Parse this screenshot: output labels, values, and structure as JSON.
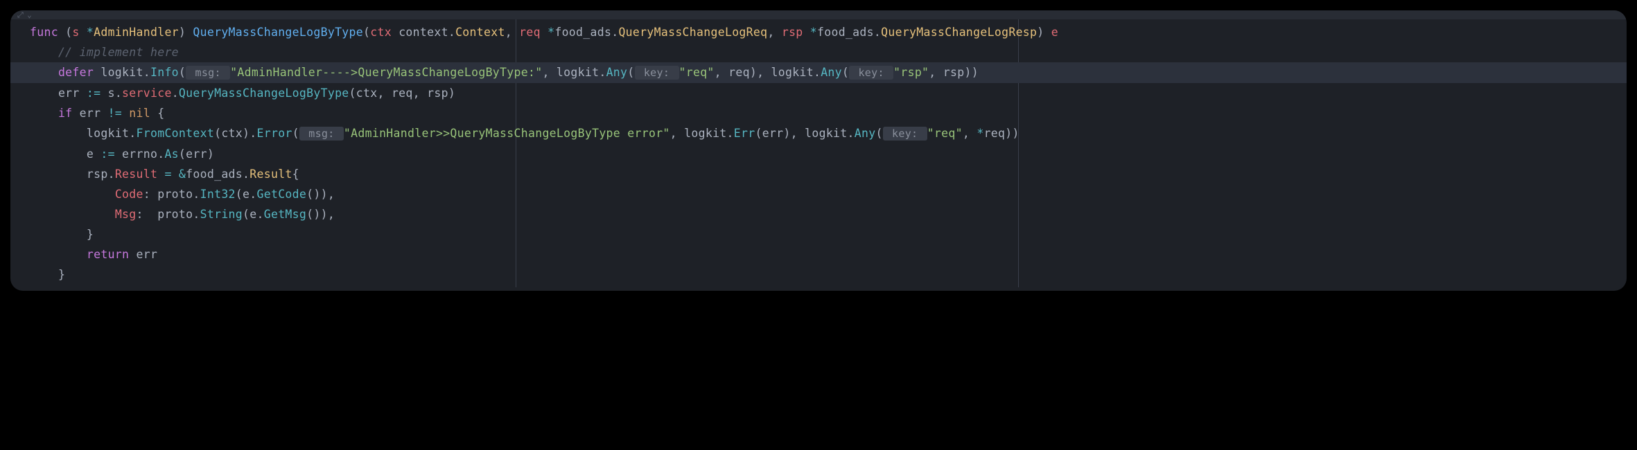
{
  "topbar": {
    "icon1": "⤢",
    "icon2": "⌄"
  },
  "code": {
    "line1": {
      "func": "func",
      "open_paren": " (",
      "s": "s",
      "star": " *",
      "type1": "AdminHandler",
      "close_paren": ") ",
      "fname": "QueryMassChangeLogByType",
      "open_args": "(",
      "ctx": "ctx ",
      "pkg1": "context",
      "dot1": ".",
      "ctxtype": "Context",
      "comma1": ", ",
      "req": "req ",
      "star2": "*",
      "pkg2": "food_ads",
      "dot2": ".",
      "reqtype": "QueryMassChangeLogReq",
      "comma2": ", ",
      "rsp": "rsp ",
      "star3": "*",
      "pkg3": "food_ads",
      "dot3": ".",
      "rsptype": "QueryMassChangeLogResp",
      "close_args": ") ",
      "e": "e"
    },
    "line2": {
      "indent": "    ",
      "comment": "// implement here"
    },
    "line3": {
      "indent": "    ",
      "defer": "defer ",
      "logkit": "logkit",
      "dot1": ".",
      "info": "Info",
      "open": "(",
      "hint_msg": " msg: ",
      "str1": "\"AdminHandler---->QueryMassChangeLogByType:\"",
      "comma1": ", ",
      "logkit2": "logkit",
      "dot2": ".",
      "any1": "Any",
      "open2": "(",
      "hint_key1": " key: ",
      "str2": "\"req\"",
      "comma2": ", ",
      "req": "req",
      "close2": ")",
      "comma3": ", ",
      "logkit3": "logkit",
      "dot3": ".",
      "any2": "Any",
      "open3": "(",
      "hint_key2": " key: ",
      "str3": "\"rsp\"",
      "comma4": ", ",
      "rsp": "rsp",
      "close3": "))"
    },
    "line4": {
      "indent": "    ",
      "err": "err ",
      "assign": ":= ",
      "s": "s",
      "dot1": ".",
      "service": "service",
      "dot2": ".",
      "method": "QueryMassChangeLogByType",
      "open": "(",
      "ctx": "ctx",
      "c1": ", ",
      "req": "req",
      "c2": ", ",
      "rsp": "rsp",
      "close": ")"
    },
    "line5": {
      "indent": "    ",
      "if": "if ",
      "err": "err ",
      "ne": "!= ",
      "nil": "nil",
      "brace": " {"
    },
    "line6": {
      "indent": "        ",
      "logkit": "logkit",
      "dot1": ".",
      "fc": "FromContext",
      "open1": "(",
      "ctx": "ctx",
      "close1": ")",
      "dot2": ".",
      "error": "Error",
      "open2": "(",
      "hint_msg": " msg: ",
      "str1": "\"AdminHandler>>QueryMassChangeLogByType error\"",
      "c1": ", ",
      "logkit2": "logkit",
      "dot3": ".",
      "errm": "Err",
      "open3": "(",
      "err": "err",
      "close3": ")",
      "c2": ", ",
      "logkit3": "logkit",
      "dot4": ".",
      "any": "Any",
      "open4": "(",
      "hint_key": " key: ",
      "str2": "\"req\"",
      "c3": ", ",
      "star": "*",
      "req": "req",
      "close4": "))"
    },
    "line7": {
      "indent": "        ",
      "e": "e ",
      "assign": ":= ",
      "errno": "errno",
      "dot": ".",
      "as": "As",
      "open": "(",
      "err": "err",
      "close": ")"
    },
    "line8": {
      "indent": "        ",
      "rsp": "rsp",
      "dot": ".",
      "result": "Result",
      "eq": " = ",
      "amp": "&",
      "pkg": "food_ads",
      "dot2": ".",
      "type": "Result",
      "brace": "{"
    },
    "line9": {
      "indent": "            ",
      "code": "Code",
      "colon": ": ",
      "proto": "proto",
      "dot": ".",
      "int32": "Int32",
      "open": "(",
      "e": "e",
      "dot2": ".",
      "getcode": "GetCode",
      "call": "()",
      "close": "),"
    },
    "line10": {
      "indent": "            ",
      "msg": "Msg",
      "colon": ":  ",
      "proto": "proto",
      "dot": ".",
      "string": "String",
      "open": "(",
      "e": "e",
      "dot2": ".",
      "getmsg": "GetMsg",
      "call": "()",
      "close": "),"
    },
    "line11": {
      "indent": "        ",
      "brace": "}"
    },
    "line12": {
      "indent": "        ",
      "return": "return ",
      "err": "err"
    },
    "line13": {
      "indent": "    ",
      "brace": "}"
    }
  }
}
